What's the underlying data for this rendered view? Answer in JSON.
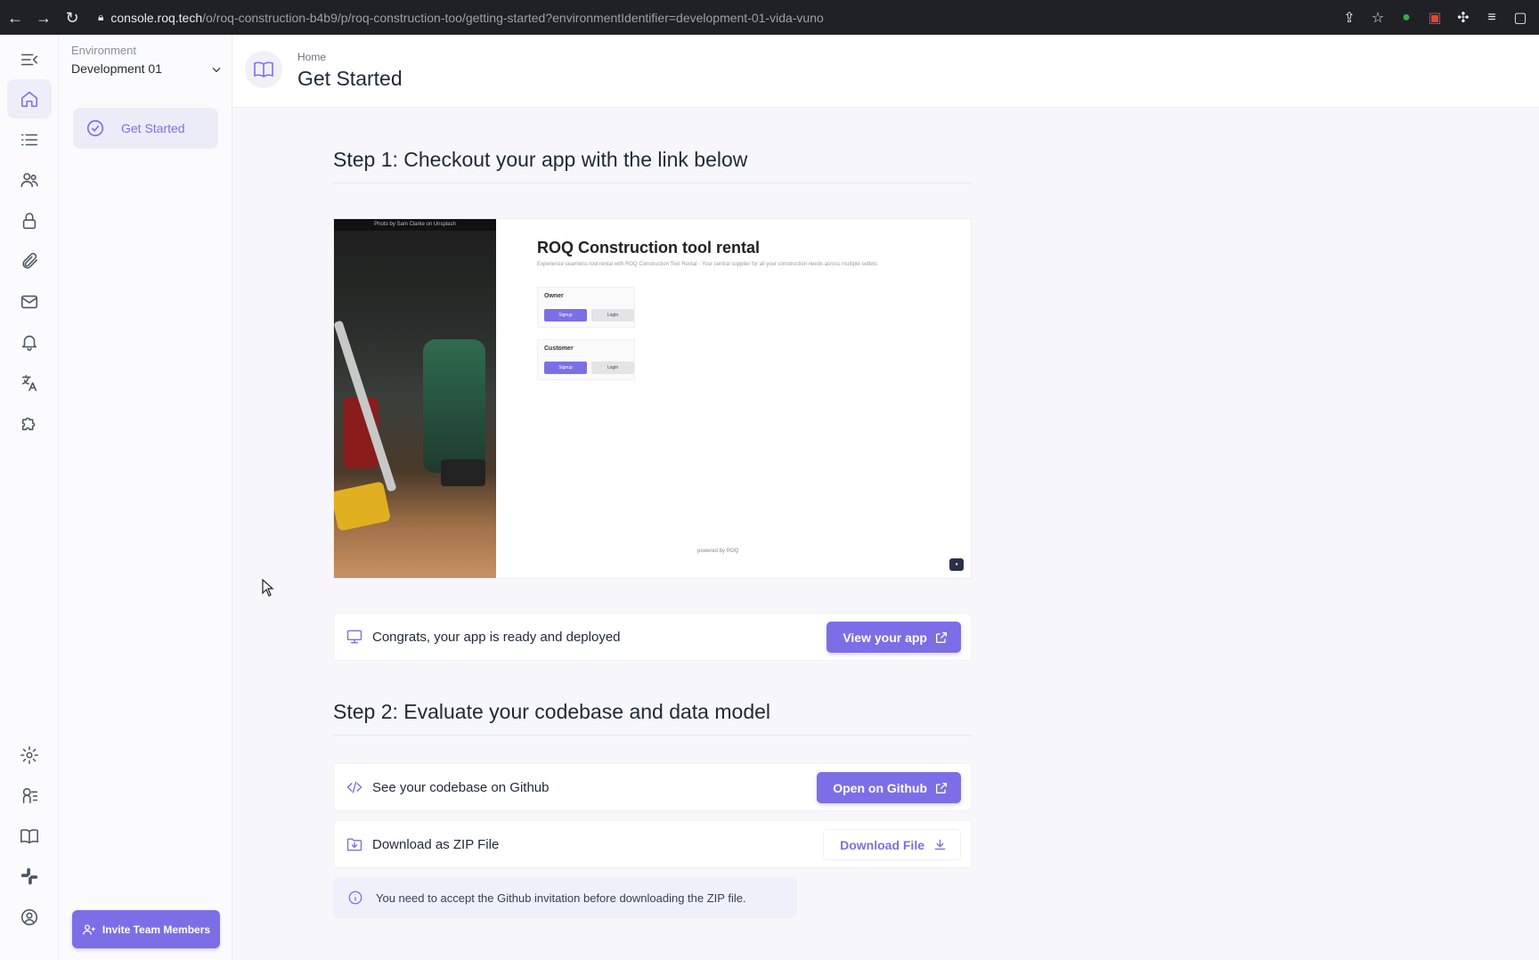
{
  "browser": {
    "url_host": "console.roq.tech",
    "url_path": "/o/roq-construction-b4b9/p/roq-construction-too/getting-started?environmentIdentifier=development-01-vida-vuno"
  },
  "sidebar": {
    "environment_label": "Environment",
    "environment_value": "Development 01",
    "nav_item": "Get Started",
    "invite_label": "Invite Team Members"
  },
  "header": {
    "breadcrumb": "Home",
    "title": "Get Started"
  },
  "step1": {
    "title": "Step 1: Checkout your app with the link below",
    "preview": {
      "photo_credit": "Photo by Sam Clarke on Unsplash",
      "app_title": "ROQ Construction tool rental",
      "app_subtitle": "Experience seamless tool rental with ROQ Construction Tool Rental - Your central supplier for all your construction needs across multiple outlets",
      "roles": [
        {
          "name": "Owner",
          "signup": "Signup",
          "login": "Login"
        },
        {
          "name": "Customer",
          "signup": "Signup",
          "login": "Login"
        }
      ],
      "powered_by": "powered by ROQ"
    },
    "deployed_text": "Congrats, your app is ready and deployed",
    "view_app_label": "View your app"
  },
  "step2": {
    "title": "Step 2: Evaluate your codebase and data model",
    "github_text": "See your codebase on Github",
    "github_button": "Open on Github",
    "zip_text": "Download as ZIP File",
    "zip_button": "Download File",
    "info_text": "You need to accept the Github invitation before downloading the ZIP file."
  },
  "colors": {
    "accent": "#7c6ee6",
    "background": "#f7f7fb",
    "chrome": "#202124"
  },
  "icons": {
    "rail": [
      "collapse-menu-icon",
      "home-icon",
      "list-icon",
      "users-icon",
      "lock-icon",
      "paperclip-icon",
      "mail-icon",
      "bell-icon",
      "translate-icon",
      "puzzle-icon",
      "settings-icon",
      "hierarchy-icon",
      "book-icon",
      "slack-icon",
      "account-icon"
    ]
  }
}
